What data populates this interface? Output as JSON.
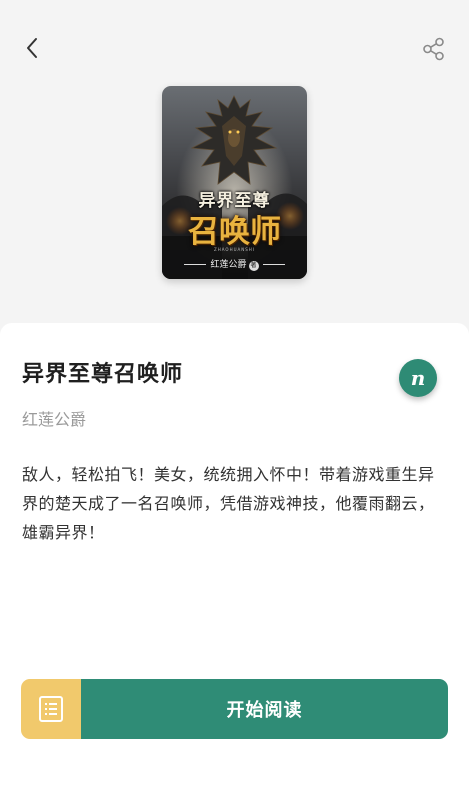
{
  "header": {
    "back_icon": "chevron-left-icon",
    "share_icon": "share-icon"
  },
  "cover": {
    "title_top": "异界至尊",
    "title_main": "召唤师",
    "subtitle": "ZHAOHUANSHI",
    "author": "红莲公爵",
    "author_mark": "著"
  },
  "book": {
    "title": "异界至尊召唤师",
    "author": "红莲公爵",
    "synopsis": "敌人，轻松拍飞！美女，统统拥入怀中！带着游戏重生异界的楚天成了一名召唤师，凭借游戏神技，他覆雨翻云，雄霸异界！",
    "badge_letter": "n"
  },
  "actions": {
    "catalog_icon": "catalog-list-icon",
    "read_label": "开始阅读"
  },
  "colors": {
    "accent": "#2f8c76",
    "catalog": "#f1c96c",
    "background": "#f4f4f4"
  }
}
